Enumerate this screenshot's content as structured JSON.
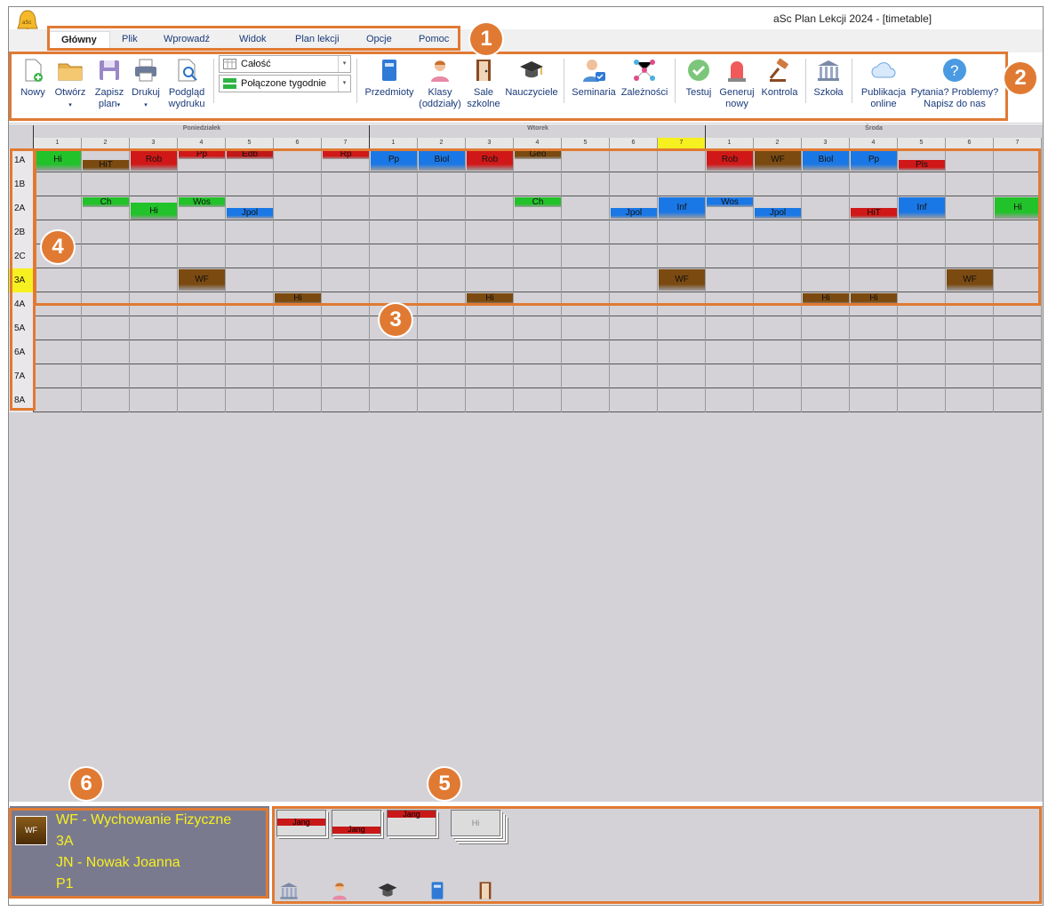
{
  "window": {
    "title": "aSc Plan Lekcji 2024  - [timetable]"
  },
  "tabs": [
    "Główny",
    "Plik",
    "Wprowadź",
    "Widok",
    "Plan lekcji",
    "Opcje",
    "Pomoc"
  ],
  "ribbon": {
    "new": "Nowy",
    "open": "Otwórz",
    "save_1": "Zapisz",
    "save_2": "plan",
    "print": "Drukuj",
    "preview_1": "Podgląd",
    "preview_2": "wydruku",
    "combo1": "Całość",
    "combo2": "Połączone tygodnie",
    "subjects": "Przedmioty",
    "classes_1": "Klasy",
    "classes_2": "(oddziały)",
    "rooms_1": "Sale",
    "rooms_2": "szkolne",
    "teachers": "Nauczyciele",
    "seminars": "Seminaria",
    "dependencies": "Zależności",
    "test": "Testuj",
    "generate_1": "Generuj",
    "generate_2": "nowy",
    "control": "Kontrola",
    "school": "Szkoła",
    "publish_1": "Publikacja",
    "publish_2": "online",
    "help_1": "Pytania? Problemy?",
    "help_2": "Napisz do nas"
  },
  "days": [
    "Poniedziałek",
    "Wtorek",
    "Środa"
  ],
  "periods": [
    "1",
    "2",
    "3",
    "4",
    "5",
    "6",
    "7"
  ],
  "classes": [
    "1A",
    "1B",
    "2A",
    "2B",
    "2C",
    "3A",
    "4A",
    "5A",
    "6A",
    "7A",
    "8A"
  ],
  "cards": [
    {
      "label": "Hi",
      "row": 0,
      "day": 0,
      "p": 0,
      "color": "#22c22a",
      "pos": "full"
    },
    {
      "label": "HiT",
      "row": 0,
      "day": 0,
      "p": 1,
      "color": "#7a4a10",
      "pos": "bottom"
    },
    {
      "label": "Rob",
      "row": 0,
      "day": 0,
      "p": 2,
      "color": "#d01818",
      "pos": "full"
    },
    {
      "label": "Pp",
      "row": 0,
      "day": 0,
      "p": 3,
      "color": "#d01818",
      "pos": "top"
    },
    {
      "label": "Edb",
      "row": 0,
      "day": 0,
      "p": 4,
      "color": "#c01818",
      "pos": "top"
    },
    {
      "label": "Rp",
      "row": 0,
      "day": 0,
      "p": 6,
      "color": "#d01818",
      "pos": "top"
    },
    {
      "label": "Pp",
      "row": 0,
      "day": 1,
      "p": 0,
      "color": "#1a78e6",
      "pos": "full"
    },
    {
      "label": "Biol",
      "row": 0,
      "day": 1,
      "p": 1,
      "color": "#1a78e6",
      "pos": "full"
    },
    {
      "label": "Rob",
      "row": 0,
      "day": 1,
      "p": 2,
      "color": "#d01818",
      "pos": "full"
    },
    {
      "label": "Geo",
      "row": 0,
      "day": 1,
      "p": 3,
      "color": "#7a4a10",
      "pos": "top"
    },
    {
      "label": "Rob",
      "row": 0,
      "day": 2,
      "p": 0,
      "color": "#d01818",
      "pos": "full"
    },
    {
      "label": "WF",
      "row": 0,
      "day": 2,
      "p": 1,
      "color": "#7a4a10",
      "pos": "full"
    },
    {
      "label": "Biol",
      "row": 0,
      "day": 2,
      "p": 2,
      "color": "#1a78e6",
      "pos": "full"
    },
    {
      "label": "Pp",
      "row": 0,
      "day": 2,
      "p": 3,
      "color": "#1a78e6",
      "pos": "full"
    },
    {
      "label": "Pls",
      "row": 0,
      "day": 2,
      "p": 4,
      "color": "#d01818",
      "pos": "bottom"
    },
    {
      "label": "Ch",
      "row": 2,
      "day": 0,
      "p": 1,
      "color": "#22c22a",
      "pos": "top"
    },
    {
      "label": "Hi",
      "row": 2,
      "day": 0,
      "p": 2,
      "color": "#22c22a",
      "pos": "lower"
    },
    {
      "label": "Wos",
      "row": 2,
      "day": 0,
      "p": 3,
      "color": "#22c22a",
      "pos": "top"
    },
    {
      "label": "Jpol",
      "row": 2,
      "day": 0,
      "p": 4,
      "color": "#1a78e6",
      "pos": "bottom"
    },
    {
      "label": "Ch",
      "row": 2,
      "day": 1,
      "p": 3,
      "color": "#22c22a",
      "pos": "top"
    },
    {
      "label": "Jpol",
      "row": 2,
      "day": 1,
      "p": 5,
      "color": "#1a78e6",
      "pos": "bottom"
    },
    {
      "label": "Inf",
      "row": 2,
      "day": 1,
      "p": 6,
      "color": "#1a78e6",
      "pos": "full"
    },
    {
      "label": "Wos",
      "row": 2,
      "day": 2,
      "p": 0,
      "color": "#1a78e6",
      "pos": "top"
    },
    {
      "label": "Jpol",
      "row": 2,
      "day": 2,
      "p": 1,
      "color": "#1a78e6",
      "pos": "bottom"
    },
    {
      "label": "HiT",
      "row": 2,
      "day": 2,
      "p": 3,
      "color": "#d01818",
      "pos": "bottom"
    },
    {
      "label": "Inf",
      "row": 2,
      "day": 2,
      "p": 4,
      "color": "#1a78e6",
      "pos": "full"
    },
    {
      "label": "Hi",
      "row": 2,
      "day": 2,
      "p": 6,
      "color": "#22c22a",
      "pos": "full"
    },
    {
      "label": "WF",
      "row": 5,
      "day": 0,
      "p": 3,
      "color": "#7a4a10",
      "pos": "full"
    },
    {
      "label": "WF",
      "row": 5,
      "day": 1,
      "p": 6,
      "color": "#7a4a10",
      "pos": "full"
    },
    {
      "label": "WF",
      "row": 5,
      "day": 2,
      "p": 5,
      "color": "#7a4a10",
      "pos": "full"
    },
    {
      "label": "Hi",
      "row": 6,
      "day": 0,
      "p": 5,
      "color": "#7a4a10",
      "pos": "half"
    },
    {
      "label": "Hi",
      "row": 6,
      "day": 1,
      "p": 2,
      "color": "#7a4a10",
      "pos": "half"
    },
    {
      "label": "Hi",
      "row": 6,
      "day": 2,
      "p": 2,
      "color": "#7a4a10",
      "pos": "half"
    },
    {
      "label": "Hi",
      "row": 6,
      "day": 2,
      "p": 3,
      "color": "#7a4a10",
      "pos": "half"
    }
  ],
  "info": {
    "badge": "WF",
    "line1": "WF - Wychowanie Fizyczne",
    "line2": "3A",
    "line3": "JN - Nowak Joanna",
    "line4": "P1"
  },
  "pool": [
    {
      "label": "Jang"
    },
    {
      "label": "Jang"
    },
    {
      "label": "Jang"
    },
    {
      "label": "Hi"
    }
  ],
  "callouts": [
    "1",
    "2",
    "3",
    "4",
    "5",
    "6"
  ]
}
